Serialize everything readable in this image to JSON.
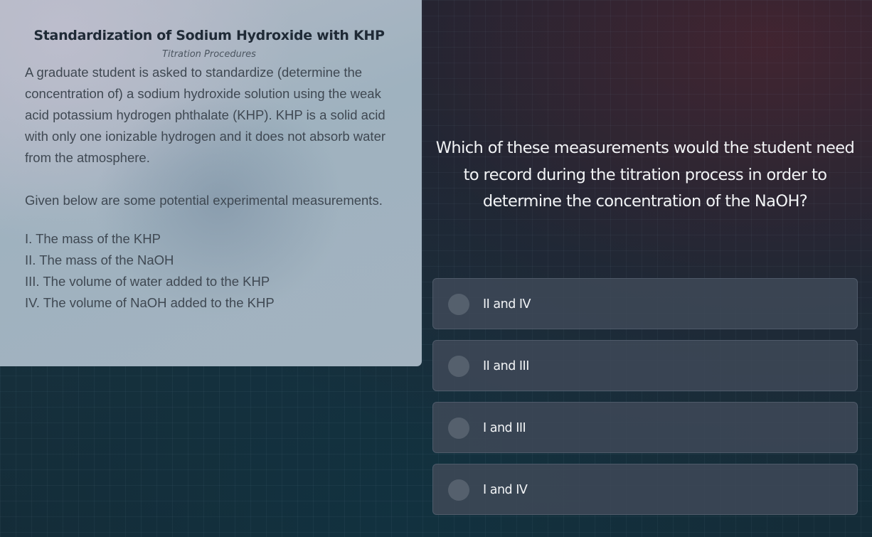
{
  "passage": {
    "title": "Standardization of Sodium Hydroxide with KHP",
    "subtitle": "Titration Procedures",
    "paragraph1": "A graduate student is asked to standardize (determine the concentration of) a sodium hydroxide solution using the weak acid potassium hydrogen phthalate (KHP). KHP is a solid acid with only one ionizable hydrogen and it does not absorb water from the atmosphere.",
    "paragraph2": "Given below are some potential experimental measurements.",
    "measurements": [
      "I. The mass of the KHP",
      "II. The mass of the NaOH",
      "III. The volume of water added to the KHP",
      "IV. The volume of NaOH added to the KHP"
    ]
  },
  "question": {
    "text": "Which of these measurements would the student need to record during the titration process in order to determine the concentration of the NaOH?"
  },
  "options": [
    {
      "label": "II and IV"
    },
    {
      "label": "II and III"
    },
    {
      "label": "I and III"
    },
    {
      "label": "I and IV"
    }
  ]
}
